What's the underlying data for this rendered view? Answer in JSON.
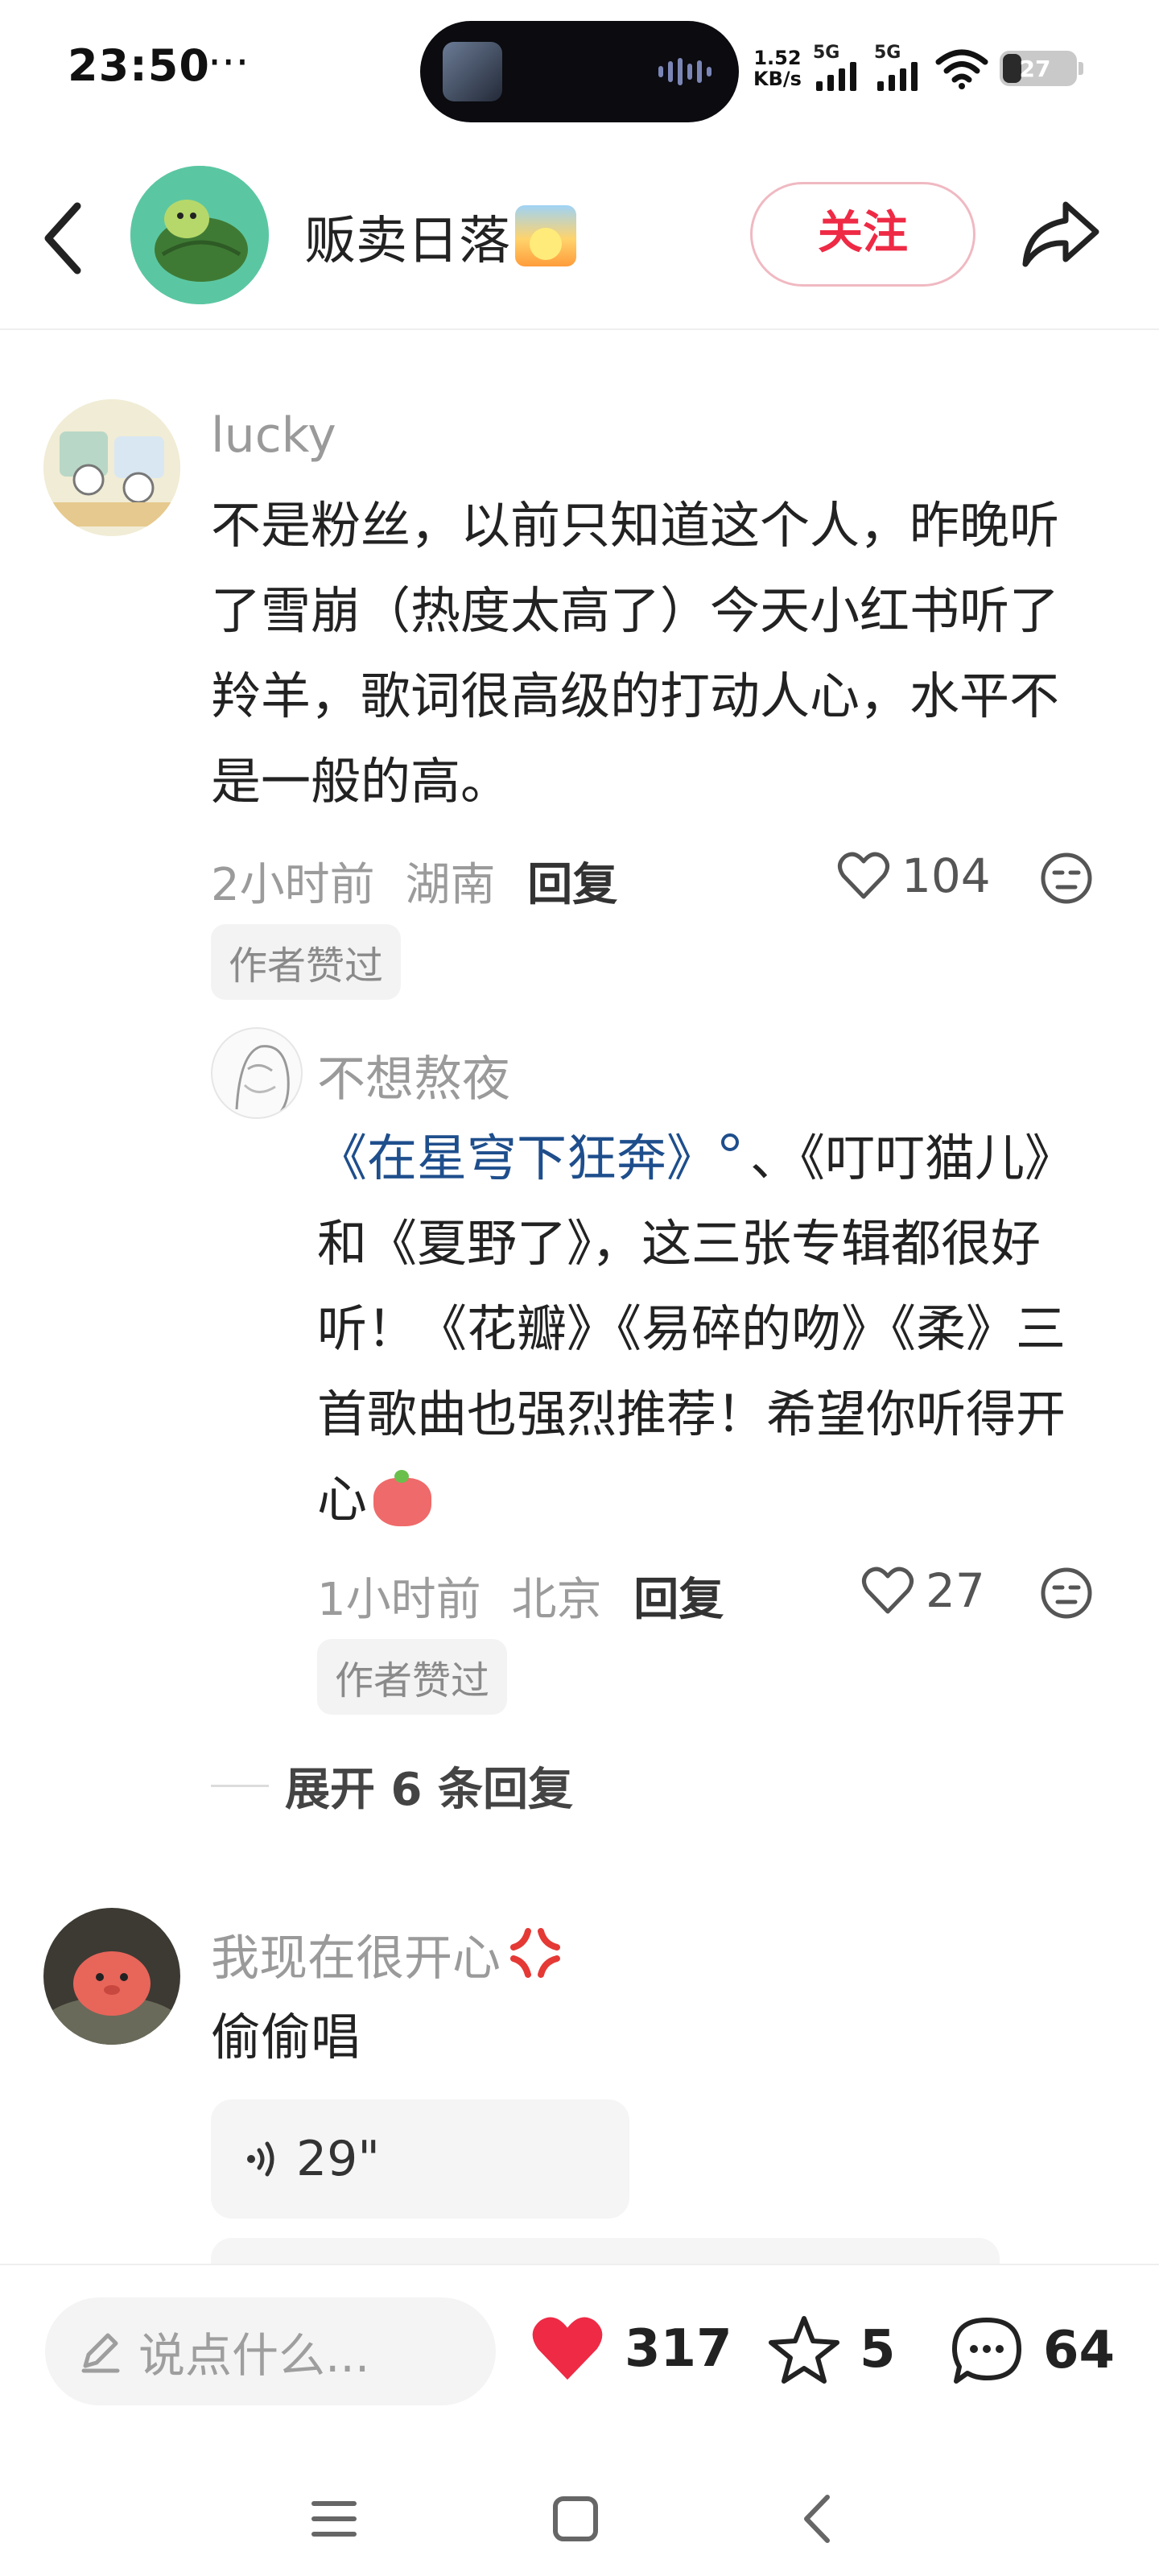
{
  "status_bar": {
    "time": "23:50",
    "dots": "···",
    "speed_top": "1.52",
    "speed_bottom": "KB/s",
    "net1": "5G",
    "net2": "5G",
    "battery": "27"
  },
  "header": {
    "author_name": "贩卖日落",
    "follow_label": "关注"
  },
  "comments": [
    {
      "username": "lucky",
      "text": "不是粉丝，以前只知道这个人，昨晚听了雪崩（热度太高了）今天小红书听了羚羊，歌词很高级的打动人心，水平不是一般的高。",
      "time": "2小时前",
      "location": "湖南",
      "reply_label": "回复",
      "likes": "104",
      "tag": "作者赞过"
    },
    {
      "username": "不想熬夜",
      "link_text": "《在星穹下狂奔》",
      "text_after": "、《叮叮猫儿》和《夏野了》，这三张专辑都很好听！《花瓣》《易碎的吻》《柔》三首歌曲也强烈推荐！希望你听得开心",
      "time": "1小时前",
      "location": "北京",
      "reply_label": "回复",
      "likes": "27",
      "tag": "作者赞过"
    },
    {
      "username": "我现在很开心",
      "text": "偷偷唱",
      "voice_duration": "29\""
    }
  ],
  "expand_label": "展开 6 条回复",
  "bottom_bar": {
    "input_placeholder": "说点什么...",
    "likes": "317",
    "stars": "5",
    "comments": "64"
  },
  "colors": {
    "accent_red": "#ee2a45",
    "link_blue": "#1e4e8c",
    "muted_text": "#9a9a9a"
  }
}
